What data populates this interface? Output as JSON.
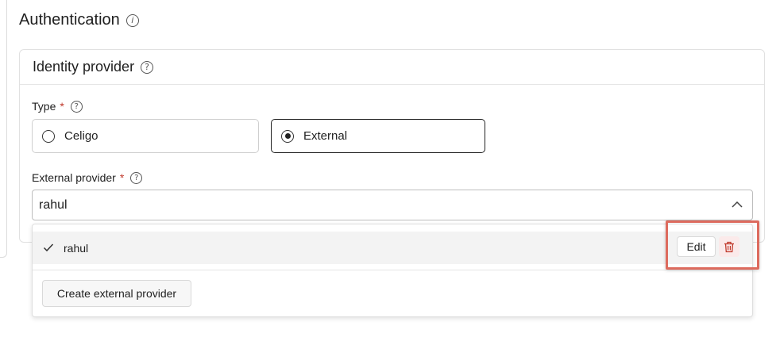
{
  "header": {
    "title": "Authentication",
    "info_icon": "info-icon"
  },
  "identity_provider": {
    "title": "Identity provider",
    "help_icon": "help-icon",
    "type_field": {
      "label": "Type",
      "required_mark": "*",
      "options": [
        {
          "label": "Celigo",
          "selected": false
        },
        {
          "label": "External",
          "selected": true
        }
      ]
    },
    "external_provider_field": {
      "label": "External provider",
      "required_mark": "*",
      "value": "rahul",
      "expanded": true,
      "options": [
        {
          "label": "rahul",
          "selected": true,
          "edit_label": "Edit",
          "delete_icon": "trash-icon"
        }
      ],
      "create_label": "Create external provider"
    }
  },
  "colors": {
    "required": "#c0392b",
    "delete": "#c0392b",
    "highlight": "#dd6b5e",
    "selected_row": "#f3f3f3"
  }
}
